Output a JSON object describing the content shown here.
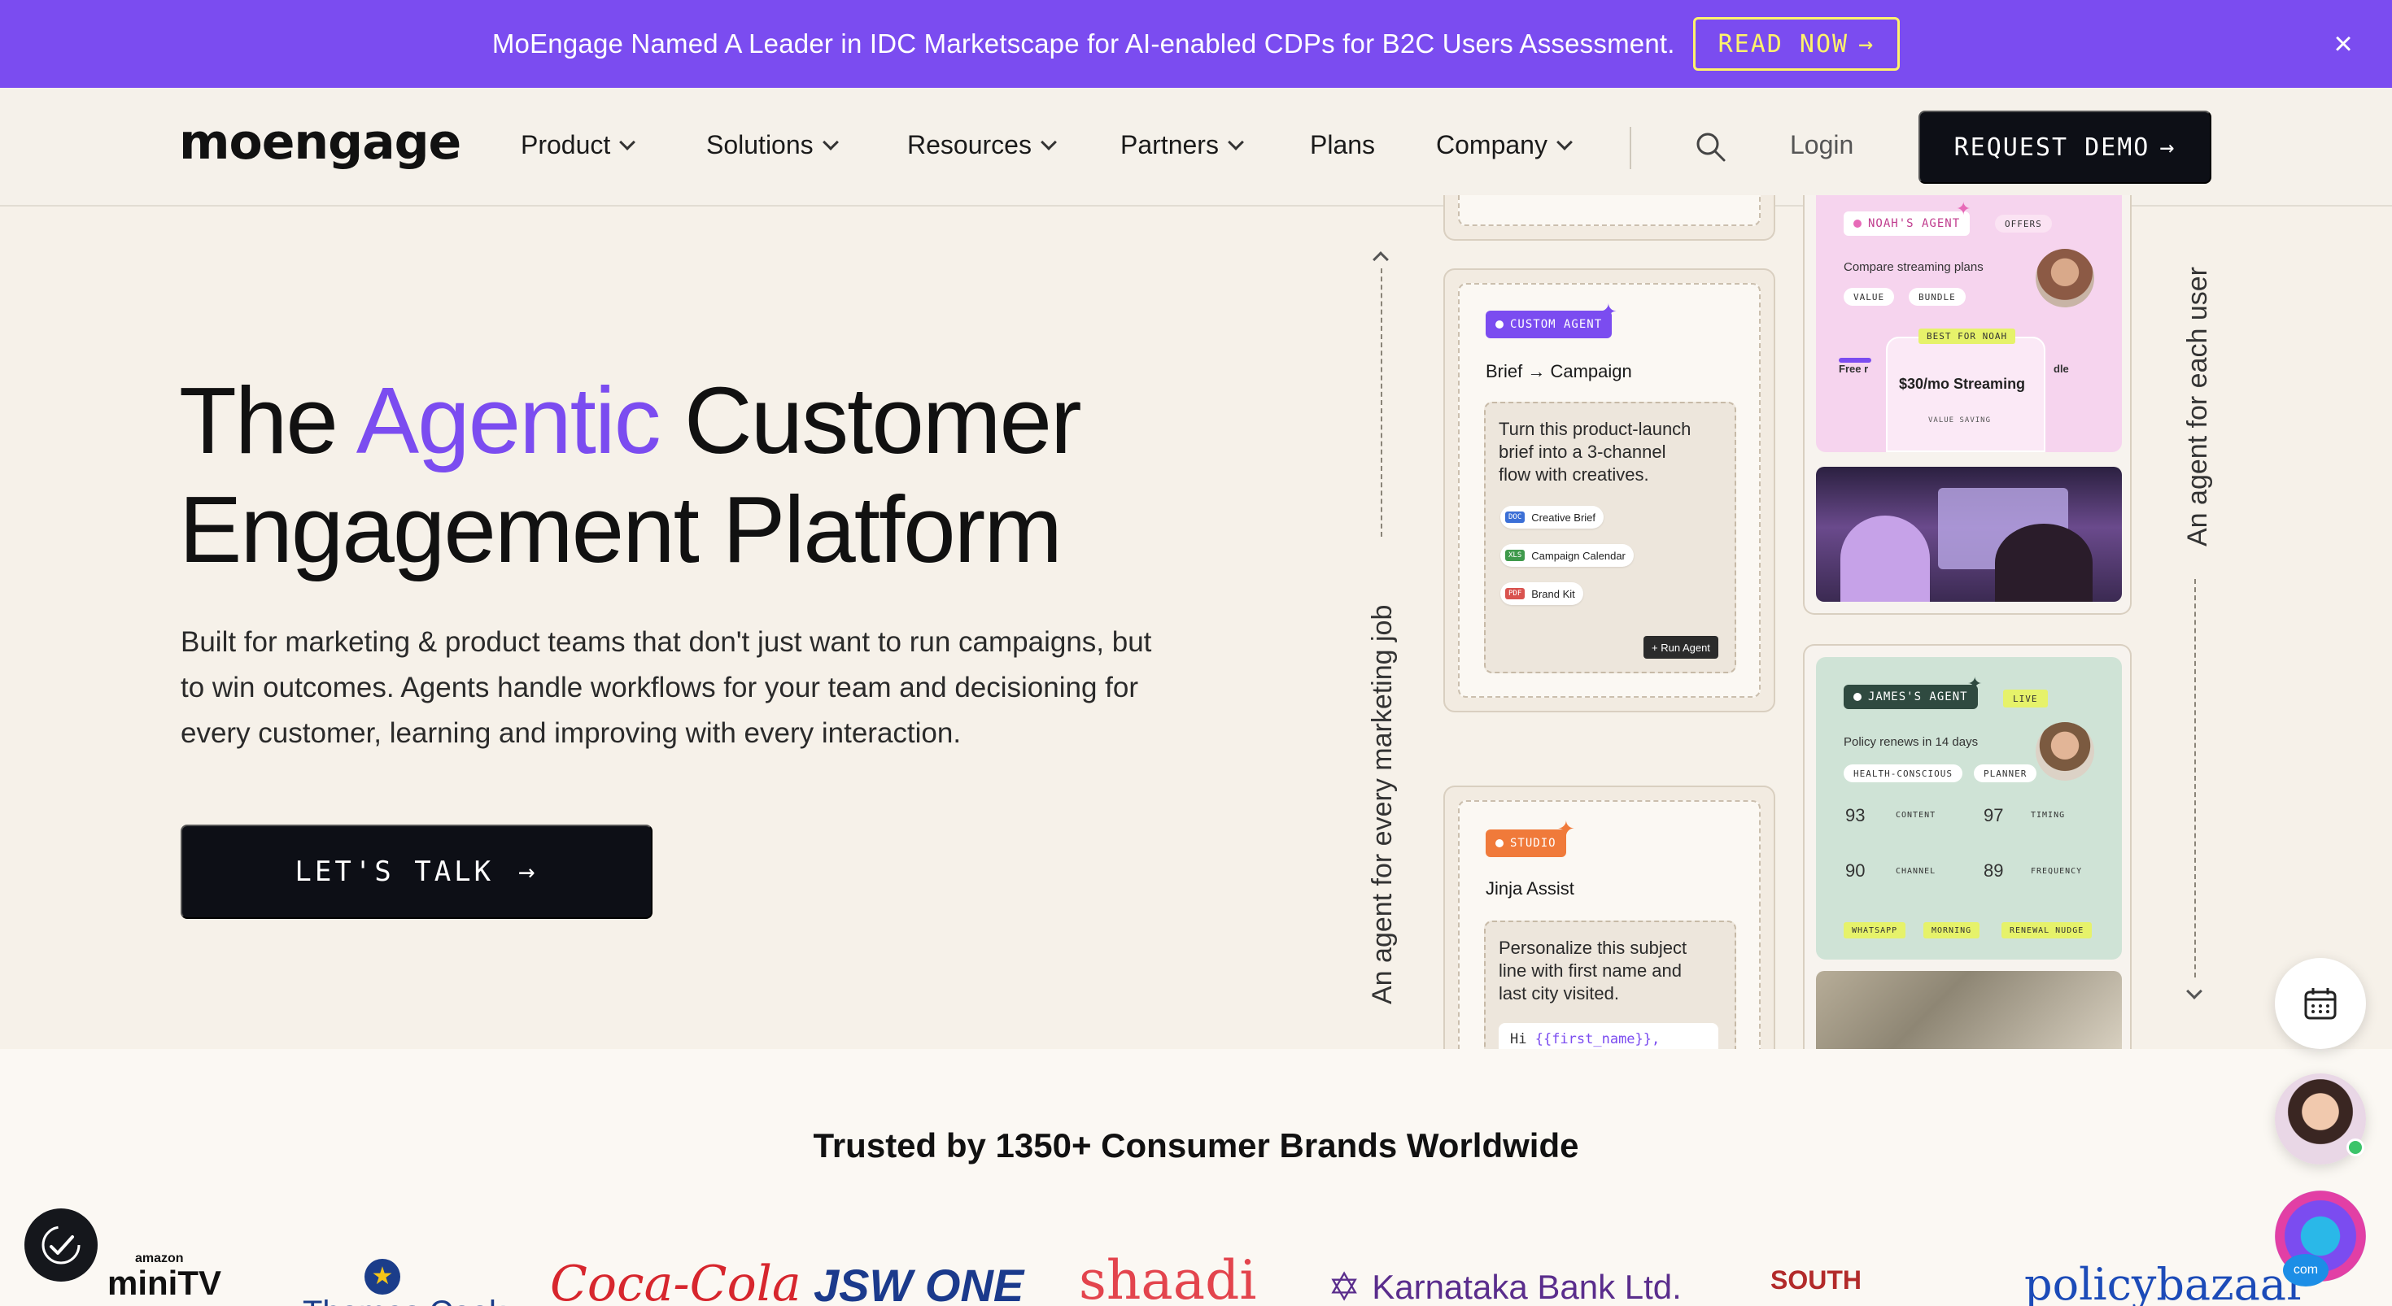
{
  "announcement": {
    "text": "MoEngage Named A Leader in IDC Marketscape for AI-enabled CDPs for B2C Users Assessment.",
    "cta": "READ NOW",
    "close_icon": "close-icon",
    "background": "#7b4cf0"
  },
  "nav": {
    "logo": "moengage",
    "items": [
      {
        "label": "Product",
        "dropdown": true
      },
      {
        "label": "Solutions",
        "dropdown": true
      },
      {
        "label": "Resources",
        "dropdown": true
      },
      {
        "label": "Partners",
        "dropdown": true
      },
      {
        "label": "Plans",
        "dropdown": false
      },
      {
        "label": "Company",
        "dropdown": true
      }
    ],
    "login": "Login",
    "demo": "REQUEST DEMO"
  },
  "hero": {
    "title_pre": "The ",
    "title_accent": "Agentic",
    "title_post": " Customer",
    "title_line2": "Engagement Platform",
    "subtitle_line1": "Built for marketing & product teams that don't just want to run campaigns, but",
    "subtitle_line2": "to win outcomes. Agents handle workflows for your team and decisioning for",
    "subtitle_line3": "every customer, learning and improving with every interaction.",
    "cta": "LET'S TALK",
    "accent_color": "#7b4cf0"
  },
  "side_labels": {
    "left": "An agent for every marketing job",
    "right": "An agent for each user"
  },
  "cards": {
    "custom": {
      "pill": "CUSTOM AGENT",
      "title": "Brief → Campaign",
      "prompt_line1": "Turn this product-launch",
      "prompt_line2": "brief into a 3-channel",
      "prompt_line3": "flow with creatives.",
      "files": [
        {
          "tag": "DOC",
          "name": "Creative Brief",
          "color": "#3b6fd6"
        },
        {
          "tag": "XLS",
          "name": "Campaign Calendar",
          "color": "#3f9a4c"
        },
        {
          "tag": "PDF",
          "name": "Brand Kit",
          "color": "#d9534f"
        }
      ],
      "run": "+ Run Agent"
    },
    "studio": {
      "pill": "STUDIO",
      "title": "Jinja Assist",
      "prompt_line1": "Personalize this subject",
      "prompt_line2": "line with first name and",
      "prompt_line3": "last city visited.",
      "code_prefix": "Hi ",
      "code_var": "{{first_name}},"
    },
    "noah": {
      "pill": "NOAH'S AGENT",
      "badge": "OFFERS",
      "desc": "Compare streaming plans",
      "tags": [
        "VALUE",
        "BUNDLE"
      ],
      "best": "BEST FOR NOAH",
      "offer": "$30/mo Streaming",
      "offer_sub": "VALUE SAVING",
      "left_frag": "Free r",
      "right_frag": "dle"
    },
    "james": {
      "pill": "JAMES'S AGENT",
      "badge": "LIVE",
      "desc": "Policy renews in 14 days",
      "tags": [
        "HEALTH-CONSCIOUS",
        "PLANNER"
      ],
      "scores": [
        {
          "value": "93",
          "label": "CONTENT"
        },
        {
          "value": "97",
          "label": "TIMING"
        },
        {
          "value": "90",
          "label": "CHANNEL"
        },
        {
          "value": "89",
          "label": "FREQUENCY"
        }
      ],
      "channels": [
        "WHATSAPP",
        "MORNING",
        "RENEWAL NUDGE"
      ]
    }
  },
  "trusted": {
    "title": "Trusted by 1350+ Consumer Brands Worldwide",
    "logos": [
      {
        "name": "amazon miniTV",
        "top": "amazon",
        "bottom": "miniTV"
      },
      {
        "name": "Thomas Cook",
        "text": "Thomas Cook"
      },
      {
        "name": "Coca-Cola",
        "text": "Coca-Cola"
      },
      {
        "name": "JSW ONE",
        "text": "JSW ONE"
      },
      {
        "name": "shaadi.com",
        "text": "shaadi"
      },
      {
        "name": "Karnataka Bank Ltd.",
        "text": "Karnataka Bank Ltd."
      },
      {
        "name": "South Indian Bank",
        "text": "SOUTH"
      },
      {
        "name": "policybazaar",
        "text": "policybazaar"
      }
    ]
  },
  "widgets": {
    "calendar": "calendar-icon",
    "accessibility": "accessibility-icon",
    "chat_avatar": "support-avatar",
    "assistant_avatar": "assistant-avatar",
    "assistant_badge": "com"
  }
}
